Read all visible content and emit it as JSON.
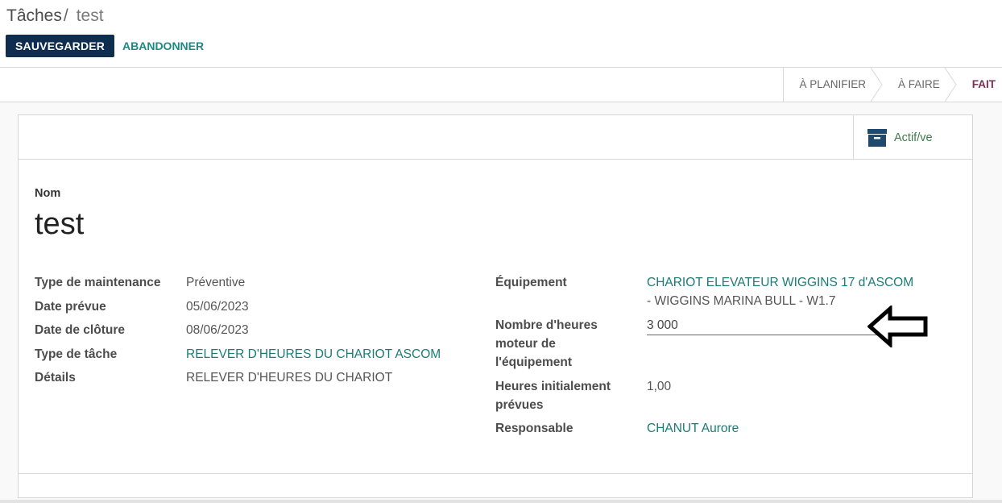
{
  "breadcrumb": {
    "parent": "Tâches",
    "separator": "/",
    "current": "test"
  },
  "toolbar": {
    "save_label": "SAUVEGARDER",
    "discard_label": "ABANDONNER"
  },
  "statusbar": {
    "stages": [
      {
        "label": "À PLANIFIER",
        "current": false
      },
      {
        "label": "À FAIRE",
        "current": false
      },
      {
        "label": "FAIT",
        "current": true
      }
    ]
  },
  "smart_button": {
    "icon": "archive-icon",
    "label": "Actif/ve",
    "color": "#3d7a4d"
  },
  "form": {
    "name_label": "Nom",
    "name_value": "test",
    "left": [
      {
        "label": "Type de maintenance",
        "value": "Préventive"
      },
      {
        "label": "Date prévue",
        "value": "05/06/2023"
      },
      {
        "label": "Date de clôture",
        "value": "08/06/2023"
      },
      {
        "label": "Type de tâche",
        "value": "RELEVER D'HEURES DU CHARIOT ASCOM"
      },
      {
        "label": "Détails",
        "value": "RELEVER D'HEURES DU CHARIOT"
      }
    ],
    "right": {
      "equipment_label": "Équipement",
      "equipment_line1": "CHARIOT ELEVATEUR WIGGINS 17 d'ASCOM",
      "equipment_line2": "- WIGGINS MARINA BULL - W1.7",
      "hours_label_line1": "Nombre d'heures",
      "hours_label_line2": "moteur de",
      "hours_label_line3": "l'équipement",
      "hours_value": "3 000",
      "planned_label_line1": "Heures initialement",
      "planned_label_line2": "prévues",
      "planned_value": "1,00",
      "responsible_label": "Responsable",
      "responsible_value": "CHANUT Aurore"
    }
  },
  "colors": {
    "primary": "#0e2d4f",
    "link": "#1b7b76",
    "current_stage": "#7b2f52"
  },
  "annotation": {
    "icon": "left-arrow-icon"
  }
}
